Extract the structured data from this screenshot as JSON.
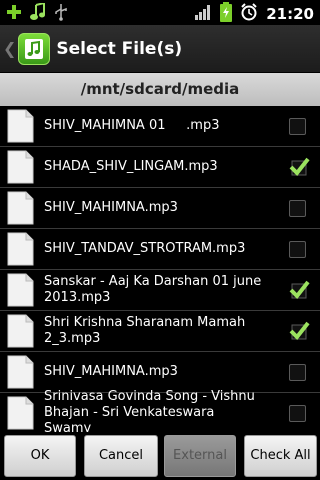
{
  "status_bar": {
    "time": "21:20",
    "left_icons": [
      "plus-icon",
      "music-note-icon",
      "usb-icon"
    ],
    "right_icons": [
      "signal-icon",
      "battery-charging-icon",
      "alarm-icon"
    ]
  },
  "title_bar": {
    "title": "Select File(s)",
    "back_icon": "chevron-left-icon",
    "app_icon": "music-file-icon"
  },
  "path": "/mnt/sdcard/media",
  "files": [
    {
      "name": "SHIV_MAHIMNA 01     .mp3",
      "checked": false
    },
    {
      "name": "SHADA_SHIV_LINGAM.mp3",
      "checked": true
    },
    {
      "name": "SHIV_MAHIMNA.mp3",
      "checked": false
    },
    {
      "name": "SHIV_TANDAV_STROTRAM.mp3",
      "checked": false
    },
    {
      "name": "Sanskar - Aaj Ka Darshan 01 june 2013.mp3",
      "checked": true
    },
    {
      "name": "Shri Krishna Sharanam Mamah 2_3.mp3",
      "checked": true
    },
    {
      "name": "SHIV_MAHIMNA.mp3",
      "checked": false
    },
    {
      "name": "Srinivasa Govinda Song - Vishnu Bhajan - Sri Venkateswara Swamy",
      "checked": false
    }
  ],
  "buttons": {
    "ok": "OK",
    "cancel": "Cancel",
    "external": "External",
    "check_all": "Check All"
  },
  "colors": {
    "accent_green": "#7ccf2a",
    "background": "#000000"
  }
}
